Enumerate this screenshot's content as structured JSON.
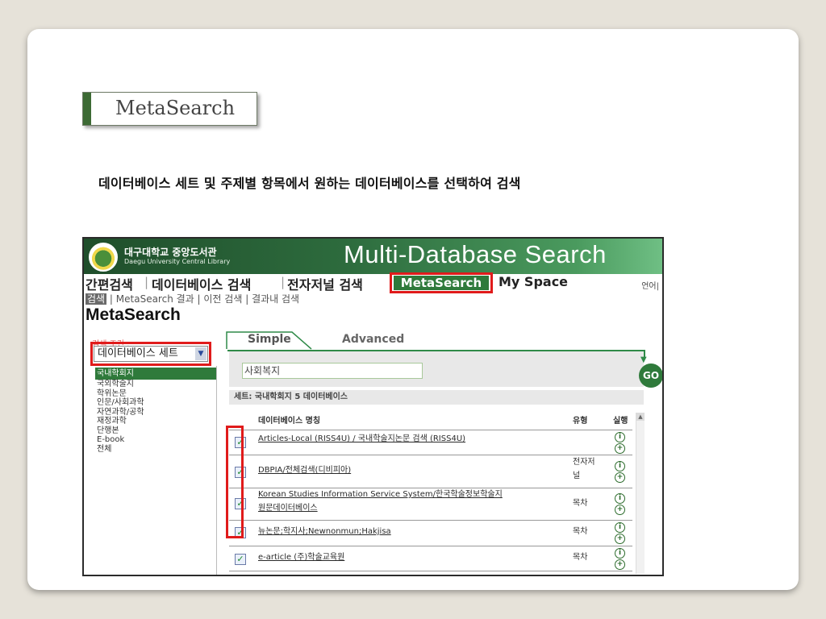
{
  "slide": {
    "title": "MetaSearch",
    "description": "데이터베이스 세트 및 주제별 항목에서 원하는 데이터베이스를 선택하여 검색"
  },
  "site": {
    "library_name_ko": "대구대학교 중앙도서관",
    "library_name_en": "Daegu University Central Library",
    "banner_title": "Multi-Database Search"
  },
  "nav": {
    "items": [
      "간편검색",
      "데이터베이스 검색",
      "전자저널 검색",
      "MetaSearch",
      "My Space"
    ],
    "language": "언어|"
  },
  "subnav": {
    "current": "검색",
    "items": [
      "MetaSearch 결과",
      "이전 검색",
      "결과내 검색"
    ]
  },
  "page_heading": "MetaSearch",
  "sidebar": {
    "label": "검색 조건 :",
    "select_value": "데이터베이스 세트",
    "categories": [
      "국내학회지",
      "국외학술지",
      "학위논문",
      "인문/사회과학",
      "자연과학/공학",
      "재정과학",
      "단행본",
      "E-book",
      "전체"
    ]
  },
  "tabs": {
    "simple": "Simple",
    "advanced": "Advanced"
  },
  "search": {
    "query": "사회복지",
    "go_label": "GO"
  },
  "set_info": "세트: 국내학회지 5 데이터베이스",
  "table": {
    "headers": {
      "name": "데이터베이스 명칭",
      "type": "유형",
      "action": "실행"
    },
    "rows": [
      {
        "name": "Articles-Local (RISS4U) / 국내학술지논문 검색 (RISS4U)",
        "name2": "",
        "type": "",
        "type2": "",
        "checked": true
      },
      {
        "name": "DBPIA/전체검색(디비피아)",
        "name2": "",
        "type": "전자저",
        "type2": "널",
        "checked": true
      },
      {
        "name": "Korean Studies Information Service System/한국학술정보학술지",
        "name2": "원문데이터베이스",
        "type": "목차",
        "type2": "",
        "checked": true
      },
      {
        "name": "뉴논문;학지사;Newnonmun;Hakjisa",
        "name2": "",
        "type": "목차",
        "type2": "",
        "checked": true
      },
      {
        "name": "e-article (주)학술교육원",
        "name2": "",
        "type": "목차",
        "type2": "",
        "checked": true
      }
    ]
  },
  "colors": {
    "brand_green": "#2f7a3b",
    "highlight_red": "#e01b1b"
  }
}
